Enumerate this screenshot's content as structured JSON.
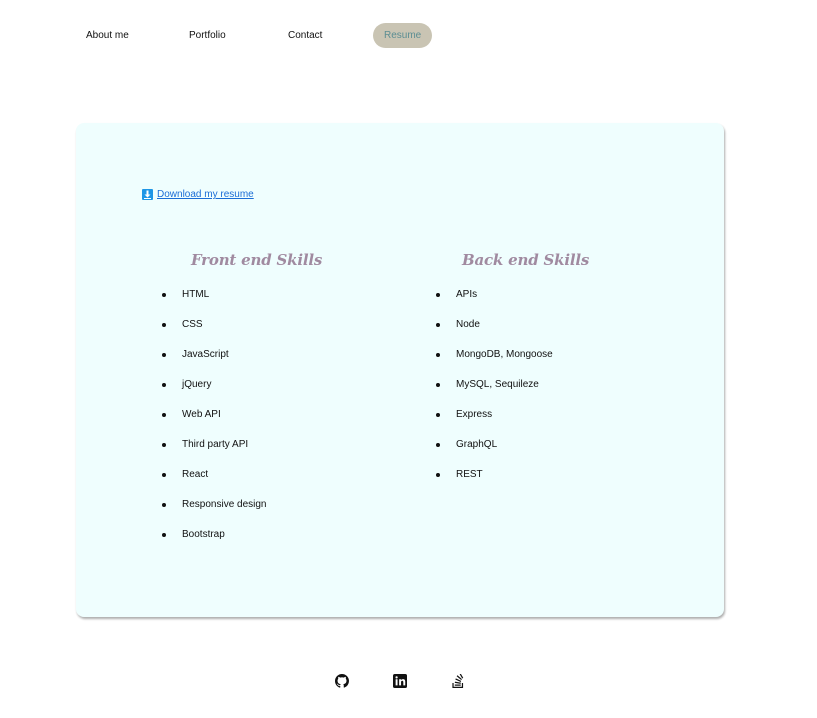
{
  "nav": {
    "items": [
      {
        "label": "About me"
      },
      {
        "label": "Portfolio"
      },
      {
        "label": "Contact"
      },
      {
        "label": "Resume"
      }
    ]
  },
  "resume": {
    "download_label": "Download my resume",
    "download_icon": "download-icon"
  },
  "front_end": {
    "title": "Front end Skills",
    "items": [
      "HTML",
      "CSS",
      "JavaScript",
      "jQuery",
      "Web API",
      "Third party API",
      "React",
      "Responsive design",
      "Bootstrap"
    ]
  },
  "back_end": {
    "title": "Back end Skills",
    "items": [
      "APIs",
      "Node",
      "MongoDB, Mongoose",
      "MySQL, Sequileze",
      "Express",
      "GraphQL",
      "REST"
    ]
  },
  "footer": {
    "icons": [
      "github-icon",
      "linkedin-icon",
      "stackoverflow-icon"
    ]
  },
  "colors": {
    "card_background": "#effefe",
    "active_tab_background": "#c9c4b3",
    "active_tab_text": "#5c8e93",
    "heading": "#a08aa0",
    "link": "#1a6dd6"
  }
}
